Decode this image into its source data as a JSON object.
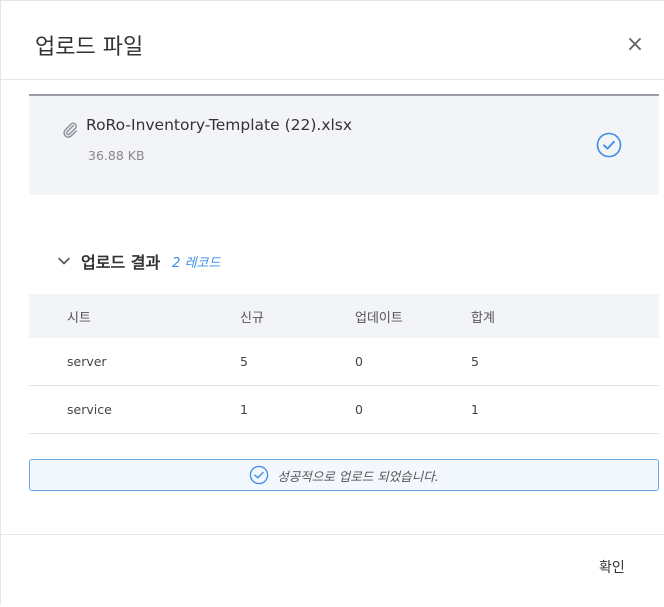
{
  "dialog": {
    "title": "업로드 파일",
    "close_symbol": "×"
  },
  "file": {
    "name": "RoRo-Inventory-Template (22).xlsx",
    "size": "36.88 KB",
    "icon": "paperclip-icon",
    "status_icon": "check-circle-icon"
  },
  "results": {
    "title": "업로드 결과",
    "record_count": "2 레코드",
    "columns": [
      "시트",
      "신규",
      "업데이트",
      "합계"
    ],
    "rows": [
      [
        "server",
        "5",
        "0",
        "5"
      ],
      [
        "service",
        "1",
        "0",
        "1"
      ]
    ]
  },
  "message": {
    "text": "성공적으로 업로드 되었습니다."
  },
  "footer": {
    "confirm_label": "확인"
  },
  "colors": {
    "accent": "#3a8ee6",
    "card_background": "#f2f4f7",
    "success_border": "#6aa8e8"
  }
}
